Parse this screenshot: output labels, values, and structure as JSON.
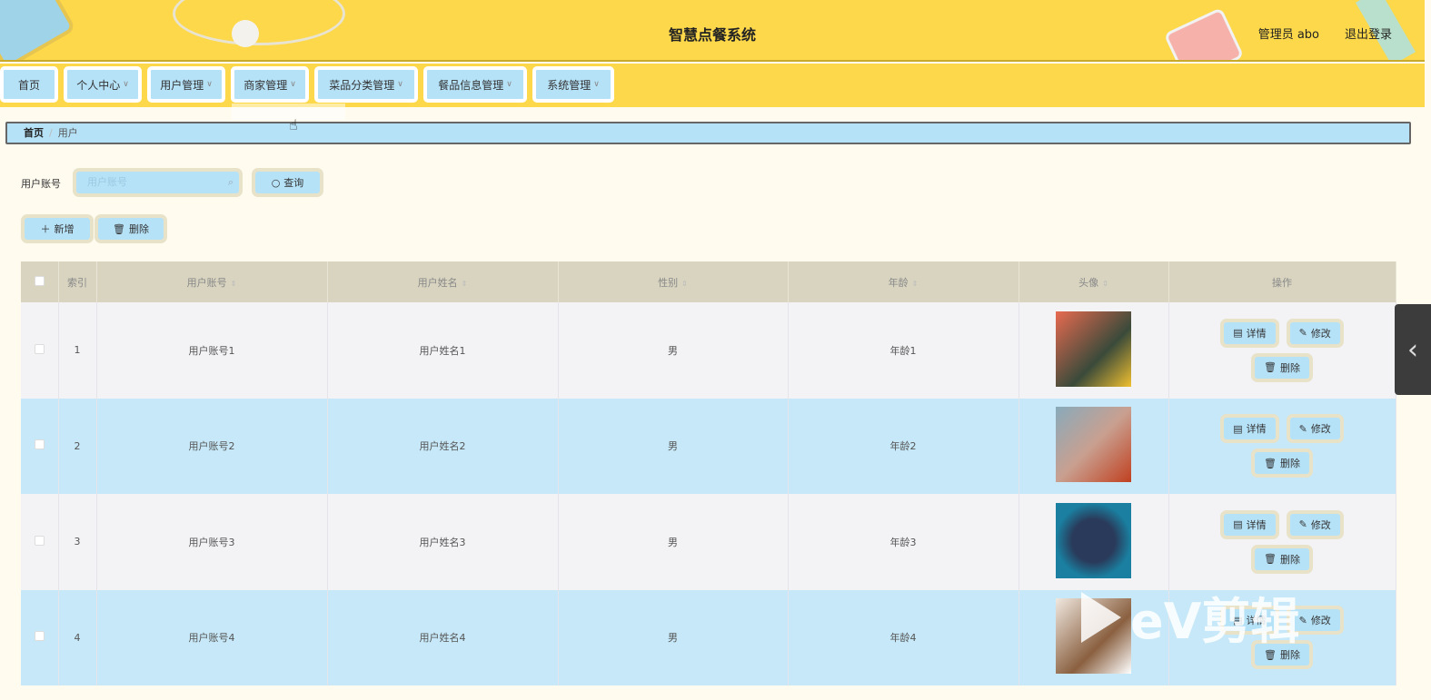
{
  "header": {
    "title": "智慧点餐系统",
    "user": "管理员 abo",
    "logout": "退出登录"
  },
  "nav": [
    {
      "label": "首页",
      "dropdown": false
    },
    {
      "label": "个人中心",
      "dropdown": true
    },
    {
      "label": "用户管理",
      "dropdown": true
    },
    {
      "label": "商家管理",
      "dropdown": true
    },
    {
      "label": "菜品分类管理",
      "dropdown": true
    },
    {
      "label": "餐品信息管理",
      "dropdown": true
    },
    {
      "label": "系统管理",
      "dropdown": true
    }
  ],
  "breadcrumb": {
    "home": "首页",
    "sep": "/",
    "current": "用户"
  },
  "search": {
    "label": "用户账号",
    "placeholder": "用户账号",
    "query": "查询"
  },
  "actions": {
    "add": "新增",
    "delete": "删除"
  },
  "table": {
    "headers": {
      "index": "索引",
      "account": "用户账号",
      "name": "用户姓名",
      "gender": "性别",
      "age": "年龄",
      "avatar": "头像",
      "ops": "操作"
    },
    "rows": [
      {
        "index": "1",
        "account": "用户账号1",
        "name": "用户姓名1",
        "gender": "男",
        "age": "年龄1"
      },
      {
        "index": "2",
        "account": "用户账号2",
        "name": "用户姓名2",
        "gender": "男",
        "age": "年龄2"
      },
      {
        "index": "3",
        "account": "用户账号3",
        "name": "用户姓名3",
        "gender": "男",
        "age": "年龄3"
      },
      {
        "index": "4",
        "account": "用户账号4",
        "name": "用户姓名4",
        "gender": "男",
        "age": "年龄4"
      }
    ],
    "row_ops": {
      "detail": "详情",
      "edit": "修改",
      "delete": "删除"
    }
  },
  "watermark": "eV剪辑"
}
